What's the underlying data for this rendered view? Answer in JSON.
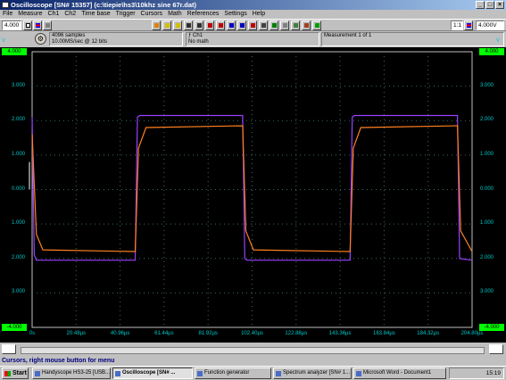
{
  "window": {
    "title": "Oscilloscope  [SN# 15357]  (c:\\tiepie\\hs3\\10khz sine 67r.dat)"
  },
  "menu": [
    "File",
    "Measure",
    "Ch1",
    "Ch2",
    "Time base",
    "Trigger",
    "Cursors",
    "Math",
    "References",
    "Settings",
    "Help"
  ],
  "toolbar": {
    "ch1_range": "4.000",
    "ch2_range": "4.000V",
    "ch2_label": "1:1"
  },
  "info": {
    "samples": "4096 samples",
    "sample_rate": "10.00MS/sec @ 12 bits",
    "trigger_channel": "Ch1",
    "math": "No math",
    "measurement": "Measurement 1 of 1"
  },
  "screen": {
    "unit_left": "V",
    "unit_right": "V",
    "y_top_marker": "4.000",
    "y_bottom_marker": "-4.000",
    "y_labels_left": [
      "3.000",
      "2.000",
      "1.000",
      "0.000",
      "1.000",
      "2.000",
      "3.000"
    ],
    "y_labels_right": [
      "3.000",
      "2.000",
      "1.000",
      "0.000",
      "1.000",
      "2.000",
      "3.000"
    ],
    "x_labels": [
      "0s",
      "20.48µs",
      "40.96µs",
      "61.44µs",
      "81.92µs",
      "102.40µs",
      "122.88µs",
      "143.36µs",
      "163.84µs",
      "184.32µs",
      "204.80µs"
    ],
    "colors": {
      "background": "#000000",
      "grid": "#3a6a6a",
      "ch1": "#9a40ff",
      "ch2": "#ff8020",
      "axis_text": "#00c8c8",
      "marker": "#00ff00"
    }
  },
  "status_bar": {
    "message": "Cursors, right mouse button for menu"
  },
  "taskbar": {
    "start": "Start",
    "tasks": [
      "Handyscope HS3-25 [USB...",
      "Oscilloscope  [SN# ...",
      "Function generator",
      "Spectrum analyzer  [SN# 1...",
      "Microsoft Word - Document1"
    ],
    "clock": "15:19"
  },
  "chart_data": {
    "type": "line",
    "title": "",
    "xlabel": "",
    "ylabel": "V",
    "xlim": [
      0,
      204.8
    ],
    "ylim": [
      -4,
      4
    ],
    "x_ticks": [
      "0s",
      "20.48µs",
      "40.96µs",
      "61.44µs",
      "81.92µs",
      "102.40µs",
      "122.88µs",
      "143.36µs",
      "163.84µs",
      "184.32µs",
      "204.80µs"
    ],
    "grid": true,
    "series": [
      {
        "color": "#9a40ff",
        "x": [
          0,
          1,
          2,
          48,
          49,
          50,
          98,
          99,
          100,
          148,
          149,
          150,
          198,
          199,
          204.8
        ],
        "y": [
          2.1,
          -1.9,
          -2.05,
          -2.05,
          2.1,
          2.15,
          2.15,
          -2.0,
          -2.05,
          -2.05,
          2.1,
          2.15,
          2.15,
          -2.0,
          -2.05
        ]
      },
      {
        "color": "#ff8020",
        "x": [
          0,
          2,
          5,
          48,
          49.5,
          53,
          98,
          99.5,
          103,
          148,
          149.5,
          153,
          198,
          199.5,
          204.8
        ],
        "y": [
          1.6,
          -1.3,
          -1.75,
          -1.8,
          1.2,
          1.8,
          1.85,
          -1.2,
          -1.75,
          -1.8,
          1.2,
          1.8,
          1.85,
          -1.2,
          -1.8
        ]
      }
    ]
  }
}
